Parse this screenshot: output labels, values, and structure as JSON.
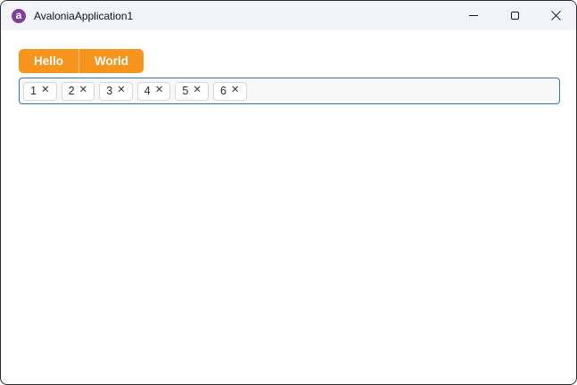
{
  "window": {
    "title": "AvaloniaApplication1",
    "app_icon": "avalonia-logo",
    "app_icon_glyph": "a",
    "controls": [
      "minimize",
      "maximize",
      "close"
    ]
  },
  "tabs": [
    {
      "label": "Hello",
      "selected": true
    },
    {
      "label": "World",
      "selected": false
    }
  ],
  "tagbox": {
    "close_glyph": "✕",
    "tags": [
      {
        "label": "1"
      },
      {
        "label": "2"
      },
      {
        "label": "3"
      },
      {
        "label": "4"
      },
      {
        "label": "5"
      },
      {
        "label": "6"
      }
    ]
  },
  "colors": {
    "accent_orange": "#f7941d",
    "focus_border_blue": "#2f78b5",
    "titlebar_bg": "#f2f4f9",
    "icon_purple": "#7f3f98"
  }
}
